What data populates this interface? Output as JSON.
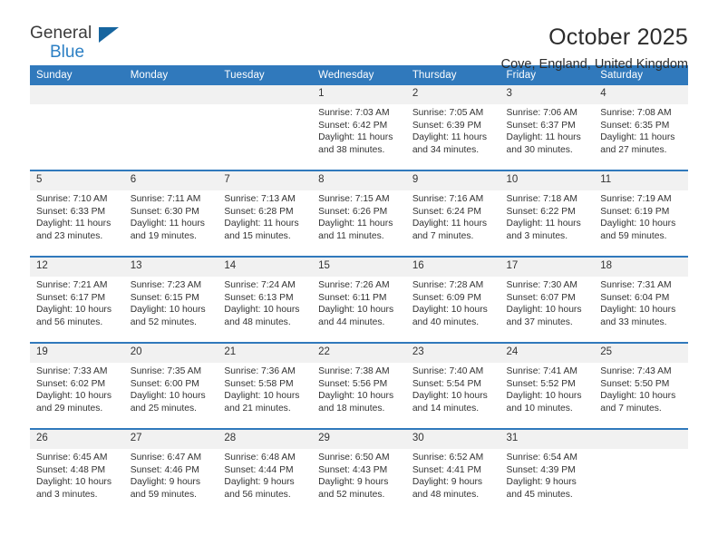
{
  "brand": {
    "name_top": "General",
    "name_bottom": "Blue",
    "triangle_color": "#17659f",
    "blue_text_color": "#2b7fc4"
  },
  "header": {
    "title": "October 2025",
    "subtitle": "Cove, England, United Kingdom"
  },
  "theme": {
    "header_blue": "#3079bc",
    "daynum_band": "#f1f1f1",
    "text": "#333333"
  },
  "weekdays": [
    "Sunday",
    "Monday",
    "Tuesday",
    "Wednesday",
    "Thursday",
    "Friday",
    "Saturday"
  ],
  "weeks": [
    [
      {
        "day": "",
        "sunrise": "",
        "sunset": "",
        "daylight": ""
      },
      {
        "day": "",
        "sunrise": "",
        "sunset": "",
        "daylight": ""
      },
      {
        "day": "",
        "sunrise": "",
        "sunset": "",
        "daylight": ""
      },
      {
        "day": "1",
        "sunrise": "Sunrise: 7:03 AM",
        "sunset": "Sunset: 6:42 PM",
        "daylight": "Daylight: 11 hours and 38 minutes."
      },
      {
        "day": "2",
        "sunrise": "Sunrise: 7:05 AM",
        "sunset": "Sunset: 6:39 PM",
        "daylight": "Daylight: 11 hours and 34 minutes."
      },
      {
        "day": "3",
        "sunrise": "Sunrise: 7:06 AM",
        "sunset": "Sunset: 6:37 PM",
        "daylight": "Daylight: 11 hours and 30 minutes."
      },
      {
        "day": "4",
        "sunrise": "Sunrise: 7:08 AM",
        "sunset": "Sunset: 6:35 PM",
        "daylight": "Daylight: 11 hours and 27 minutes."
      }
    ],
    [
      {
        "day": "5",
        "sunrise": "Sunrise: 7:10 AM",
        "sunset": "Sunset: 6:33 PM",
        "daylight": "Daylight: 11 hours and 23 minutes."
      },
      {
        "day": "6",
        "sunrise": "Sunrise: 7:11 AM",
        "sunset": "Sunset: 6:30 PM",
        "daylight": "Daylight: 11 hours and 19 minutes."
      },
      {
        "day": "7",
        "sunrise": "Sunrise: 7:13 AM",
        "sunset": "Sunset: 6:28 PM",
        "daylight": "Daylight: 11 hours and 15 minutes."
      },
      {
        "day": "8",
        "sunrise": "Sunrise: 7:15 AM",
        "sunset": "Sunset: 6:26 PM",
        "daylight": "Daylight: 11 hours and 11 minutes."
      },
      {
        "day": "9",
        "sunrise": "Sunrise: 7:16 AM",
        "sunset": "Sunset: 6:24 PM",
        "daylight": "Daylight: 11 hours and 7 minutes."
      },
      {
        "day": "10",
        "sunrise": "Sunrise: 7:18 AM",
        "sunset": "Sunset: 6:22 PM",
        "daylight": "Daylight: 11 hours and 3 minutes."
      },
      {
        "day": "11",
        "sunrise": "Sunrise: 7:19 AM",
        "sunset": "Sunset: 6:19 PM",
        "daylight": "Daylight: 10 hours and 59 minutes."
      }
    ],
    [
      {
        "day": "12",
        "sunrise": "Sunrise: 7:21 AM",
        "sunset": "Sunset: 6:17 PM",
        "daylight": "Daylight: 10 hours and 56 minutes."
      },
      {
        "day": "13",
        "sunrise": "Sunrise: 7:23 AM",
        "sunset": "Sunset: 6:15 PM",
        "daylight": "Daylight: 10 hours and 52 minutes."
      },
      {
        "day": "14",
        "sunrise": "Sunrise: 7:24 AM",
        "sunset": "Sunset: 6:13 PM",
        "daylight": "Daylight: 10 hours and 48 minutes."
      },
      {
        "day": "15",
        "sunrise": "Sunrise: 7:26 AM",
        "sunset": "Sunset: 6:11 PM",
        "daylight": "Daylight: 10 hours and 44 minutes."
      },
      {
        "day": "16",
        "sunrise": "Sunrise: 7:28 AM",
        "sunset": "Sunset: 6:09 PM",
        "daylight": "Daylight: 10 hours and 40 minutes."
      },
      {
        "day": "17",
        "sunrise": "Sunrise: 7:30 AM",
        "sunset": "Sunset: 6:07 PM",
        "daylight": "Daylight: 10 hours and 37 minutes."
      },
      {
        "day": "18",
        "sunrise": "Sunrise: 7:31 AM",
        "sunset": "Sunset: 6:04 PM",
        "daylight": "Daylight: 10 hours and 33 minutes."
      }
    ],
    [
      {
        "day": "19",
        "sunrise": "Sunrise: 7:33 AM",
        "sunset": "Sunset: 6:02 PM",
        "daylight": "Daylight: 10 hours and 29 minutes."
      },
      {
        "day": "20",
        "sunrise": "Sunrise: 7:35 AM",
        "sunset": "Sunset: 6:00 PM",
        "daylight": "Daylight: 10 hours and 25 minutes."
      },
      {
        "day": "21",
        "sunrise": "Sunrise: 7:36 AM",
        "sunset": "Sunset: 5:58 PM",
        "daylight": "Daylight: 10 hours and 21 minutes."
      },
      {
        "day": "22",
        "sunrise": "Sunrise: 7:38 AM",
        "sunset": "Sunset: 5:56 PM",
        "daylight": "Daylight: 10 hours and 18 minutes."
      },
      {
        "day": "23",
        "sunrise": "Sunrise: 7:40 AM",
        "sunset": "Sunset: 5:54 PM",
        "daylight": "Daylight: 10 hours and 14 minutes."
      },
      {
        "day": "24",
        "sunrise": "Sunrise: 7:41 AM",
        "sunset": "Sunset: 5:52 PM",
        "daylight": "Daylight: 10 hours and 10 minutes."
      },
      {
        "day": "25",
        "sunrise": "Sunrise: 7:43 AM",
        "sunset": "Sunset: 5:50 PM",
        "daylight": "Daylight: 10 hours and 7 minutes."
      }
    ],
    [
      {
        "day": "26",
        "sunrise": "Sunrise: 6:45 AM",
        "sunset": "Sunset: 4:48 PM",
        "daylight": "Daylight: 10 hours and 3 minutes."
      },
      {
        "day": "27",
        "sunrise": "Sunrise: 6:47 AM",
        "sunset": "Sunset: 4:46 PM",
        "daylight": "Daylight: 9 hours and 59 minutes."
      },
      {
        "day": "28",
        "sunrise": "Sunrise: 6:48 AM",
        "sunset": "Sunset: 4:44 PM",
        "daylight": "Daylight: 9 hours and 56 minutes."
      },
      {
        "day": "29",
        "sunrise": "Sunrise: 6:50 AM",
        "sunset": "Sunset: 4:43 PM",
        "daylight": "Daylight: 9 hours and 52 minutes."
      },
      {
        "day": "30",
        "sunrise": "Sunrise: 6:52 AM",
        "sunset": "Sunset: 4:41 PM",
        "daylight": "Daylight: 9 hours and 48 minutes."
      },
      {
        "day": "31",
        "sunrise": "Sunrise: 6:54 AM",
        "sunset": "Sunset: 4:39 PM",
        "daylight": "Daylight: 9 hours and 45 minutes."
      },
      {
        "day": "",
        "sunrise": "",
        "sunset": "",
        "daylight": ""
      }
    ]
  ]
}
